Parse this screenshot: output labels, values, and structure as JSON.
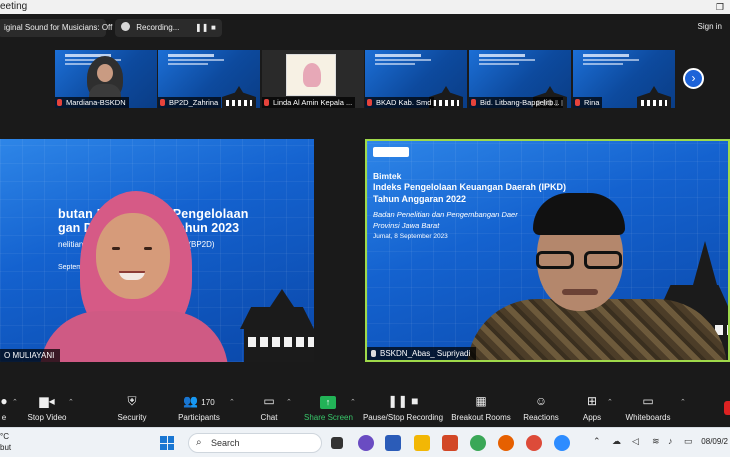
{
  "window": {
    "title": "eeting"
  },
  "topbar": {
    "original_sound": "iginal Sound for Musicians: Off",
    "recording": "Recording...",
    "pause_icon": "pause-icon",
    "stop_icon": "stop-icon",
    "signin": "Sign in"
  },
  "thumbnails": [
    {
      "name": "Mardiana-BSKDN"
    },
    {
      "name": "BP2D_Zahrina"
    },
    {
      "name": "Linda Al Amin Kepala ..."
    },
    {
      "name": "BKAD Kab. Smd"
    },
    {
      "name": "Bid. Litbang-Bappelitb..."
    },
    {
      "name": "Rina"
    }
  ],
  "main_left": {
    "slide_line1": "butan Data Indeks Pengelolaan",
    "slide_line2": "gan Daerah (IPKD) Tahun 2023",
    "slide_sub": "nelitian dan Pengembangan Daerah (BP2D)",
    "slide_date": "September 2023",
    "name": "O MULIAYANI"
  },
  "main_right": {
    "slide_line0": "Bimtek",
    "slide_line1": "Indeks Pengelolaan Keuangan Daerah (IPKD)",
    "slide_line2": "Tahun Anggaran 2022",
    "slide_sub1": "Badan Penelitian dan Pengembangan Daer",
    "slide_sub2": "Provinsi Jawa Barat",
    "slide_date": "Jumat, 8 September 2023",
    "name": "BSKDN_Abas_ Supriyadi",
    "accent": "#9fd94a"
  },
  "toolbar": {
    "mute": "e",
    "stop_video": "Stop Video",
    "security": "Security",
    "participants": "Participants",
    "participants_count": "170",
    "chat": "Chat",
    "share_screen": "Share Screen",
    "pause_stop_recording": "Pause/Stop Recording",
    "breakout_rooms": "Breakout Rooms",
    "reactions": "Reactions",
    "apps": "Apps",
    "whiteboards": "Whiteboards"
  },
  "taskbar": {
    "weather_temp": "°C",
    "weather_text": "but",
    "search_placeholder": "Search",
    "date": "08/09/2"
  }
}
